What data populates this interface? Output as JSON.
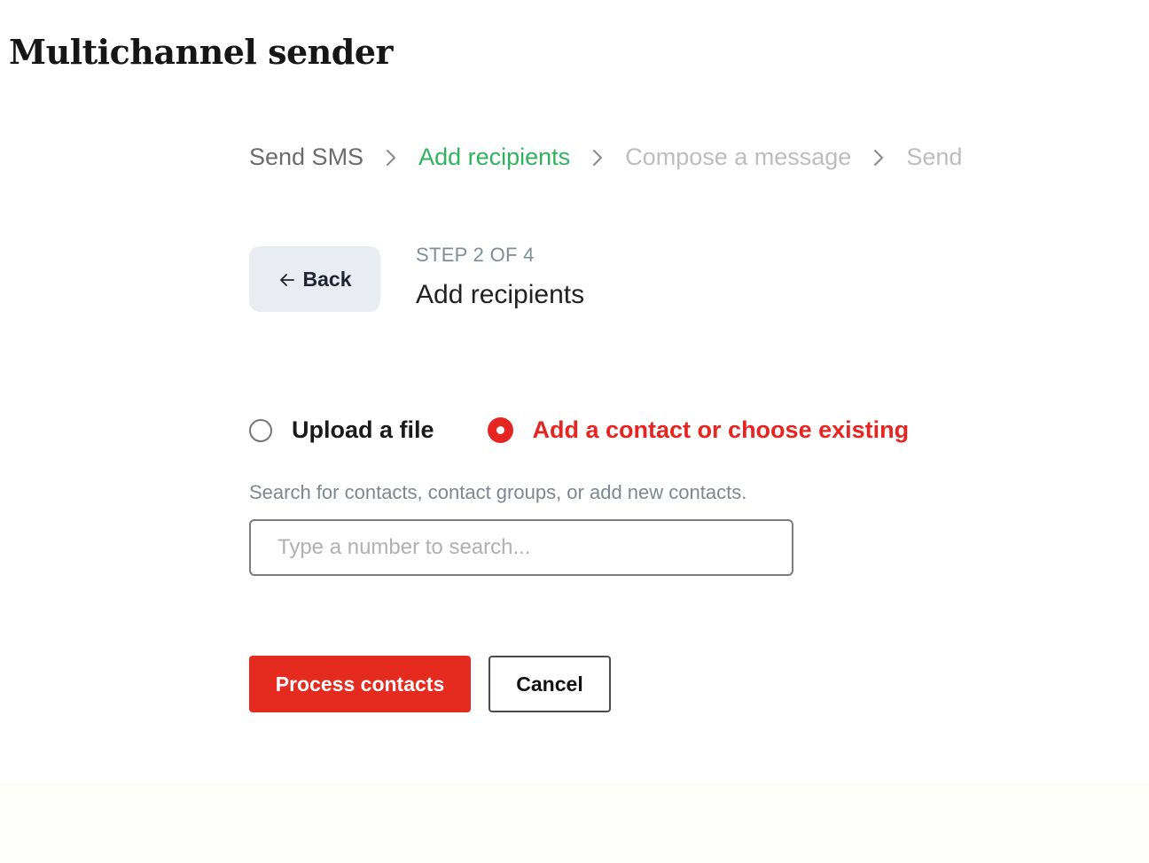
{
  "page": {
    "title": "Multichannel sender"
  },
  "breadcrumb": {
    "steps": [
      {
        "label": "Send SMS",
        "state": "done"
      },
      {
        "label": "Add recipients",
        "state": "active"
      },
      {
        "label": "Compose a message",
        "state": "pending"
      },
      {
        "label": "Send",
        "state": "pending"
      }
    ],
    "separator_icon": "chevron-right-icon"
  },
  "header": {
    "back_label": "Back",
    "back_icon": "arrow-left-icon",
    "step_label": "STEP 2 OF 4",
    "step_title": "Add recipients"
  },
  "recipient_mode": {
    "options": [
      {
        "label": "Upload a file",
        "selected": false
      },
      {
        "label": "Add a contact or choose existing",
        "selected": true
      }
    ]
  },
  "search": {
    "helper": "Search for contacts, contact groups, or add new contacts.",
    "placeholder": "Type a number to search...",
    "value": ""
  },
  "actions": {
    "primary_label": "Process contacts",
    "secondary_label": "Cancel"
  },
  "colors": {
    "accent_red": "#e52521",
    "active_green": "#2fb35c",
    "pending_gray": "#bdbdbd",
    "done_gray": "#6b6b6b"
  }
}
